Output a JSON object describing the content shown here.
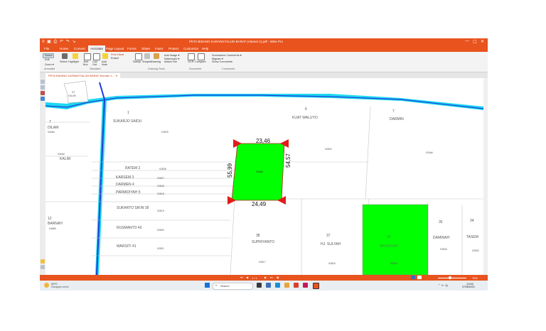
{
  "app": {
    "quick_access": "≡ ▣ ⎙ ↶ ↷ ↘",
    "title": "PETA BIDANG KARANGTALUN BARAT (Alamat 1).pdf - Wise Pro",
    "window_controls": [
      "—",
      "▢",
      "✕"
    ]
  },
  "tabs": [
    "File",
    "Home",
    "Convert",
    "Annotate",
    "Page Layout",
    "Forms",
    "Share",
    "Insert",
    "Protect",
    "Customize",
    "Help"
  ],
  "active_tab_index": 3,
  "ribbon": {
    "select": "Select",
    "edit": "Edit",
    "zoom": "Zoom ▾",
    "highlight": "Highlight",
    "textbox": "Text Box",
    "callout": "Call Out",
    "addnote": "Add Note",
    "freehand": "Free Hand",
    "eraser": "Eraser",
    "shapes": "Shapes",
    "stamp": "Stamp",
    "drawing": "Drawing",
    "add_image": "Add Image ▾",
    "watermark": "Watermark ▾",
    "attach_file": "Attach File",
    "ocr": "OCR",
    "compare": "Compare",
    "summarize": "Summarize Comments ▾",
    "migrate": "Migrate ▾",
    "show_comments": "Show Comments",
    "groups": [
      "Annotate",
      "Standard",
      "Drawing Tools",
      "Document",
      "Comments"
    ]
  },
  "document_tab": "PETA BIDANG KARANGTALUN BARAT Wonder 1...   ✕",
  "map": {
    "parcel_labels": {
      "p1": "1",
      "p1_name": "SUKARJO SAIDU",
      "p1_code": "02829",
      "p6": "6",
      "p6_name": "KUAT WALUYO",
      "p6_code": "02824",
      "p7": "7",
      "p7_name": "DARMIN",
      "p7_code": "024##",
      "p7b": "7",
      "p7b_name": "DILAM",
      "p7b_code": "04###",
      "kalim": "KALIM",
      "kalim_code": "04###",
      "top_left": "ST",
      "top_left_code": "KALIM",
      "selected_code": "02###",
      "r2": "RATEM  2",
      "r2_code": "02828",
      "r3": "KARSEM  3",
      "r3_code": "02827",
      "r4": "DARMEN  4",
      "r4_code": "02826",
      "r5": "PARMIDIYAH  5",
      "r5_code": "02818",
      "r39": "SUKARTO  SIKIN  39",
      "r39_code": "02819",
      "r40": "RUSMANTO  40",
      "r40_code": "02820",
      "r41": "WARSITI  41",
      "r41_code": "02821",
      "barnah": "BARNAH",
      "barnah_code": "04880",
      "barnah_num": "12",
      "p38": "38",
      "p38_name": "SUPRIYANTO",
      "p38_code": "02817",
      "p37": "37",
      "p37_name": "HJ. SULYAH",
      "p37_code": "02816",
      "p36": "36",
      "p36_name": "WASRIYAH",
      "p36_code": "02815",
      "p35": "35",
      "p35_name": "DAMINAH",
      "p35_code": "02843",
      "p34": "34",
      "p34_name": "TASEM",
      "p34_code": "02842"
    },
    "dimensions": {
      "top": "23,46",
      "bottom": "24,49",
      "left": "55,99",
      "right": "54,57"
    },
    "colors": {
      "river": "#1ed8f0",
      "highlight": "#00ff00",
      "marker": "#e21b1b",
      "ui_accent": "#e8531e"
    }
  },
  "statusbar": {
    "page": "1 / 1",
    "zoom": "75%"
  },
  "taskbar": {
    "weather_temp": "29°C",
    "weather_desc": "Sebagian cerah",
    "search_placeholder": "Search",
    "time": "13:52",
    "date": "27/08/2023"
  }
}
